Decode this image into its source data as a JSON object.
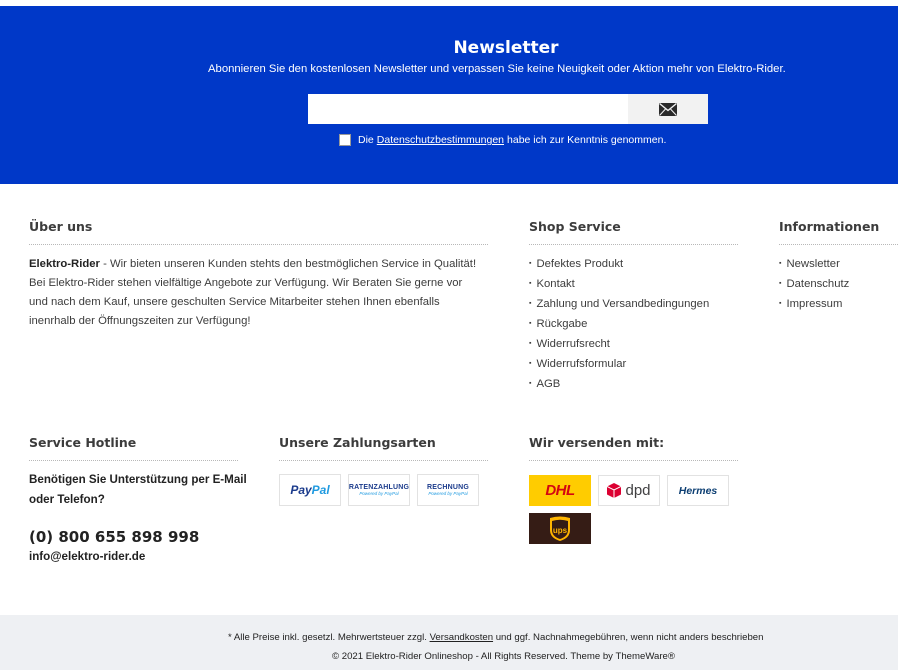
{
  "newsletter": {
    "title": "Newsletter",
    "subtitle": "Abonnieren Sie den kostenlosen Newsletter und verpassen Sie keine Neuigkeit oder Aktion mehr von Elektro-Rider.",
    "email_value": "",
    "submit_icon": "envelope-icon",
    "consent_pre": "Die",
    "consent_link": "Datenschutzbestimmungen",
    "consent_post": "habe ich zur Kenntnis genommen.",
    "bg_color": "#0038c8"
  },
  "about": {
    "title": "Über uns",
    "brand": "Elektro-Rider",
    "text": " - Wir bieten unseren Kunden stehts den bestmöglichen Service in Qualität! Bei Elektro-Rider stehen vielfältige Angebote zur Verfügung. Wir Beraten Sie gerne vor und nach dem Kauf, unsere geschulten Service Mitarbeiter stehen Ihnen ebenfalls inenrhalb der Öffnungszeiten zur Verfügung!"
  },
  "shop_service": {
    "title": "Shop Service",
    "items": [
      "Defektes Produkt",
      "Kontakt",
      "Zahlung und Versandbedingungen",
      "Rückgabe",
      "Widerrufsrecht",
      "Widerrufsformular",
      "AGB"
    ]
  },
  "informationen": {
    "title": "Informationen",
    "items": [
      "Newsletter",
      "Datenschutz",
      "Impressum"
    ]
  },
  "hotline": {
    "title": "Service Hotline",
    "question": "Benötigen Sie Unterstützung per E-Mail oder Telefon?",
    "phone": "(0) 800 655 898 998",
    "email": "info@elektro-rider.de"
  },
  "payment": {
    "title": "Unsere Zahlungsarten",
    "methods": [
      {
        "name": "PayPal",
        "part1": "Pay",
        "part2": "Pal"
      },
      {
        "name": "RATENZAHLUNG",
        "sub": "Powered by PayPal"
      },
      {
        "name": "RECHNUNG",
        "sub": "Powered by PayPal"
      }
    ]
  },
  "shipping": {
    "title": "Wir versenden mit:",
    "carriers": [
      "DHL",
      "dpd",
      "Hermes",
      "ups"
    ]
  },
  "footer": {
    "line1_pre": "* Alle Preise inkl. gesetzl. Mehrwertsteuer zzgl.",
    "line1_link": "Versandkosten",
    "line1_post": "und ggf. Nachnahmegebühren, wenn nicht anders beschrieben",
    "line2": "© 2021 Elektro-Rider Onlineshop - All Rights Reserved. Theme by ThemeWare®"
  }
}
